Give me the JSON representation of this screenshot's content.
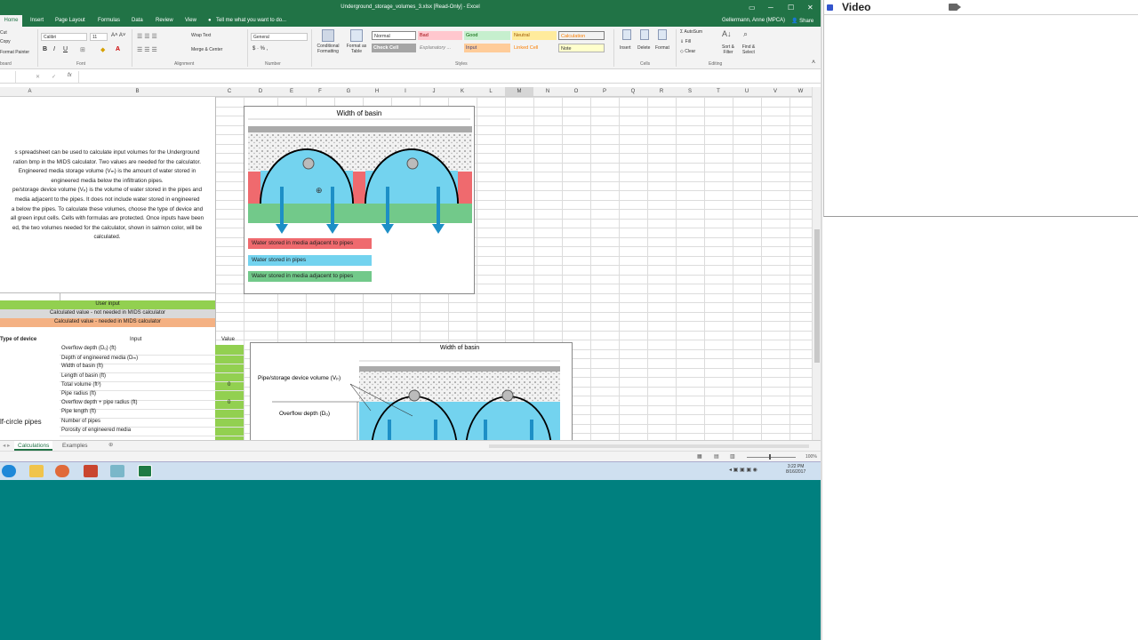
{
  "window": {
    "title": "Underground_storage_volumes_3.xlsx [Read-Only] - Excel",
    "user": "Gellermann, Anne (MPCA)",
    "share": "Share"
  },
  "ribbon_tabs": [
    "Home",
    "Insert",
    "Page Layout",
    "Formulas",
    "Data",
    "Review",
    "View"
  ],
  "tell_me": "Tell me what you want to do...",
  "clipboard": {
    "cut": "Cut",
    "copy": "Copy",
    "format_painter": "Format Painter",
    "label": "board"
  },
  "font": {
    "name": "Calibri",
    "size": "11",
    "label": "Font"
  },
  "alignment": {
    "wrap": "Wrap Text",
    "merge": "Merge & Center",
    "label": "Alignment"
  },
  "number": {
    "format": "General",
    "label": "Number"
  },
  "styles": {
    "conditional": "Conditional Formatting",
    "format_table": "Format as Table",
    "cells": [
      {
        "label": "Normal",
        "bg": "#ffffff",
        "fg": "#000000"
      },
      {
        "label": "Bad",
        "bg": "#ffc7ce",
        "fg": "#9c0006"
      },
      {
        "label": "Good",
        "bg": "#c6efce",
        "fg": "#006100"
      },
      {
        "label": "Neutral",
        "bg": "#ffeb9c",
        "fg": "#9c5700"
      },
      {
        "label": "Calculation",
        "bg": "#f2f2f2",
        "fg": "#fa7d00"
      },
      {
        "label": "Check Cell",
        "bg": "#a5a5a5",
        "fg": "#ffffff"
      },
      {
        "label": "Explanatory ...",
        "bg": "#ffffff",
        "fg": "#7f7f7f"
      },
      {
        "label": "Input",
        "bg": "#ffcc99",
        "fg": "#3f3f76"
      },
      {
        "label": "Linked Cell",
        "bg": "#ffffff",
        "fg": "#fa7d00"
      },
      {
        "label": "Note",
        "bg": "#ffffcc",
        "fg": "#000000"
      }
    ],
    "label": "Styles"
  },
  "cells_group": {
    "insert": "Insert",
    "delete": "Delete",
    "format": "Format",
    "label": "Cells"
  },
  "editing": {
    "autosum": "AutoSum",
    "fill": "Fill",
    "clear": "Clear",
    "sort": "Sort & Filter",
    "find": "Find & Select",
    "label": "Editing"
  },
  "columns": [
    "A",
    "B",
    "C",
    "D",
    "E",
    "F",
    "G",
    "H",
    "I",
    "J",
    "K",
    "L",
    "M",
    "N",
    "O",
    "P",
    "Q",
    "R",
    "S",
    "T",
    "U",
    "V",
    "W"
  ],
  "instructions": [
    "s spreadsheet can be used to calculate input volumes for the Underground",
    "ration bmp in the MIDS calculator. Two values are needed for the calculator.",
    "Engineered media storage volume (Vₘ) is the amount of water stored in",
    "engineered media below the infiltration pipes.",
    "pe/storage device volume (Vₚ) is the volume of water stored in the pipes and",
    "media adjacent to the pipes. It does not include water stored in engineered",
    "a below the pipes. To calculate these volumes, choose the type of device and",
    "all green input cells. Cells with formulas are protected. Once inputs have been",
    "ed, the two volumes needed for the calculator, shown in salmon color, will be",
    "calculated."
  ],
  "legend_bands": [
    {
      "label": "User input",
      "color": "#92d050"
    },
    {
      "label": "Calculated value - not needed in MIDS calculator",
      "color": "#d9d9d9"
    },
    {
      "label": "Calculated value - needed in MIDS calculator",
      "color": "#f4b183"
    }
  ],
  "table": {
    "header_type": "Type of device",
    "header_input": "Input",
    "header_value": "Value",
    "device": "lf-circle pipes",
    "rows": [
      {
        "label": "Overflow depth (Dₒ) (ft)",
        "value": ""
      },
      {
        "label": "Depth of engineered media (Dₘ)",
        "value": ""
      },
      {
        "label": "Width of basin (ft)",
        "value": ""
      },
      {
        "label": "Length of basin (ft)",
        "value": ""
      },
      {
        "label": "Total volume (ft³)",
        "value": "0"
      },
      {
        "label": "Pipe radius (ft)",
        "value": ""
      },
      {
        "label": "Overflow depth + pipe radius (ft)",
        "value": "0"
      },
      {
        "label": "Pipe length (ft)",
        "value": ""
      },
      {
        "label": "Number of pipes",
        "value": ""
      },
      {
        "label": "Porosity of engineered media",
        "value": ""
      }
    ]
  },
  "figure1": {
    "title": "Width of basin",
    "legend": [
      {
        "label": "Water stored in media adjacent to pipes",
        "color": "#ef6a6e"
      },
      {
        "label": "Water stored in pipes",
        "color": "#73d3ef"
      },
      {
        "label": "Water stored in media adjacent to pipes",
        "color": "#72c98a"
      }
    ]
  },
  "figure2": {
    "title": "Width of basin",
    "pipe_label": "Pipe/storage device volume (Vₚ)",
    "overflow_label": "Overflow depth (Dₒ)"
  },
  "sheet_tabs": [
    "Calculations",
    "Examples"
  ],
  "zoom": "100%",
  "clock": {
    "time": "3:22 PM",
    "date": "8/16/2017"
  },
  "video_panel": {
    "title": "Video"
  }
}
